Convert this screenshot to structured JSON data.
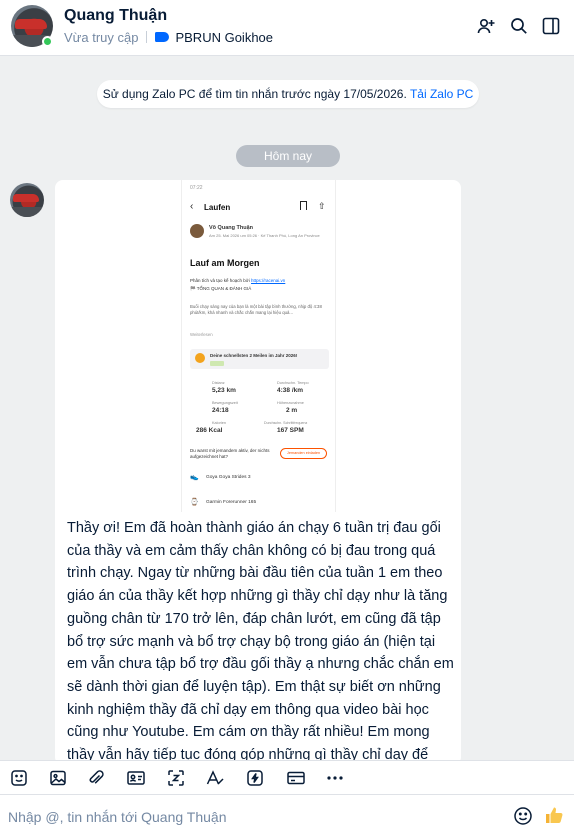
{
  "header": {
    "name": "Quang Thuận",
    "status": "Vừa truy cập",
    "tag": "PBRUN Goikhoe"
  },
  "banner": {
    "text": "Sử dụng Zalo PC để tìm tin nhắn trước ngày 17/05/2026.",
    "link": "Tải Zalo PC"
  },
  "date_divider": "Hôm nay",
  "shared_screenshot": {
    "time": "07:22",
    "title": "Laufen",
    "author": "Võ Quang Thuận",
    "meta": "Am 25. Mai 2026 um 05:26 · Kế Thanh Phú, Long An Province",
    "activity_title": "Lauf am Morgen",
    "desc1": "Phân tích và tạo kế hoạch bởi",
    "desc1_link": "https://racenai.vn",
    "desc2": "🏁 TỔNG QUAN & ĐÁNH GIÁ",
    "body": "Buổi chạy sáng nay của bạn là một bài tập bình thường, nhịp độ 4:38 phút/km, khá nhanh và chắc chắn mang lại hiệu quả...",
    "more": "Weiterlesen",
    "achievement": "Deine schnellsten 2 Meilen im Jahr 2026!",
    "stats": [
      {
        "label": "Distanz",
        "value": "5,23 km"
      },
      {
        "label": "Durchschn. Tempo",
        "value": "4:38 /km"
      },
      {
        "label": "Bewegungszeit",
        "value": "24:18"
      },
      {
        "label": "Höhenzunahme",
        "value": "2 m"
      },
      {
        "label": "Kalorien",
        "value": "286 Kcal"
      },
      {
        "label": "Durchschn. Schrittfrequenz",
        "value": "167 SPM"
      }
    ],
    "prompt": "Du warst mit jemandem aktiv, der nichts aufgezeichnet hat?",
    "prompt_button": "Jemanden einladen",
    "shoe": "Goya Goya Strides 3",
    "device": "Garmin Forerunner 165"
  },
  "message": "Thầy ơi! Em đã hoàn thành giáo án chạy 6 tuần trị đau gối của thầy và em cảm thấy chân không có bị đau trong quá trình chạy. Ngay từ những bài đầu tiên của tuần 1 em theo giáo án của thầy kết hợp những gì thầy chỉ dạy như là tăng guồng chân từ 170 trở lên, đáp chân lướt, em cũng đã tập bổ trợ sức mạnh và bổ trợ chạy bộ trong giáo án (hiện tại em vẫn chưa tập bổ trợ đầu gối thầy ạ nhưng chắc chắn em sẽ dành thời gian để luyện tập). Em thật sự biết ơn những kinh nghiệm thầy đã chỉ dạy em thông qua video bài học cũng như Youtube. Em cám ơn thầy rất nhiều! Em mong thầy vẫn hãy tiếp tục đóng góp những gì thầy chỉ dạy để cộng đồng chạy bộ được phát triển và duy trì tốt hơn! Chúc thầy luôn tiến bước!",
  "composer": {
    "placeholder": "Nhập @, tin nhắn tới Quang Thuận"
  },
  "colors": {
    "accent": "#0068ff",
    "online": "#34c759",
    "background": "#eef0f1"
  },
  "toolbar_icons": [
    "sticker-icon",
    "image-icon",
    "attachment-icon",
    "contact-card-icon",
    "screenshot-icon",
    "text-format-icon",
    "quick-message-icon",
    "todo-card-icon",
    "more-icon"
  ]
}
